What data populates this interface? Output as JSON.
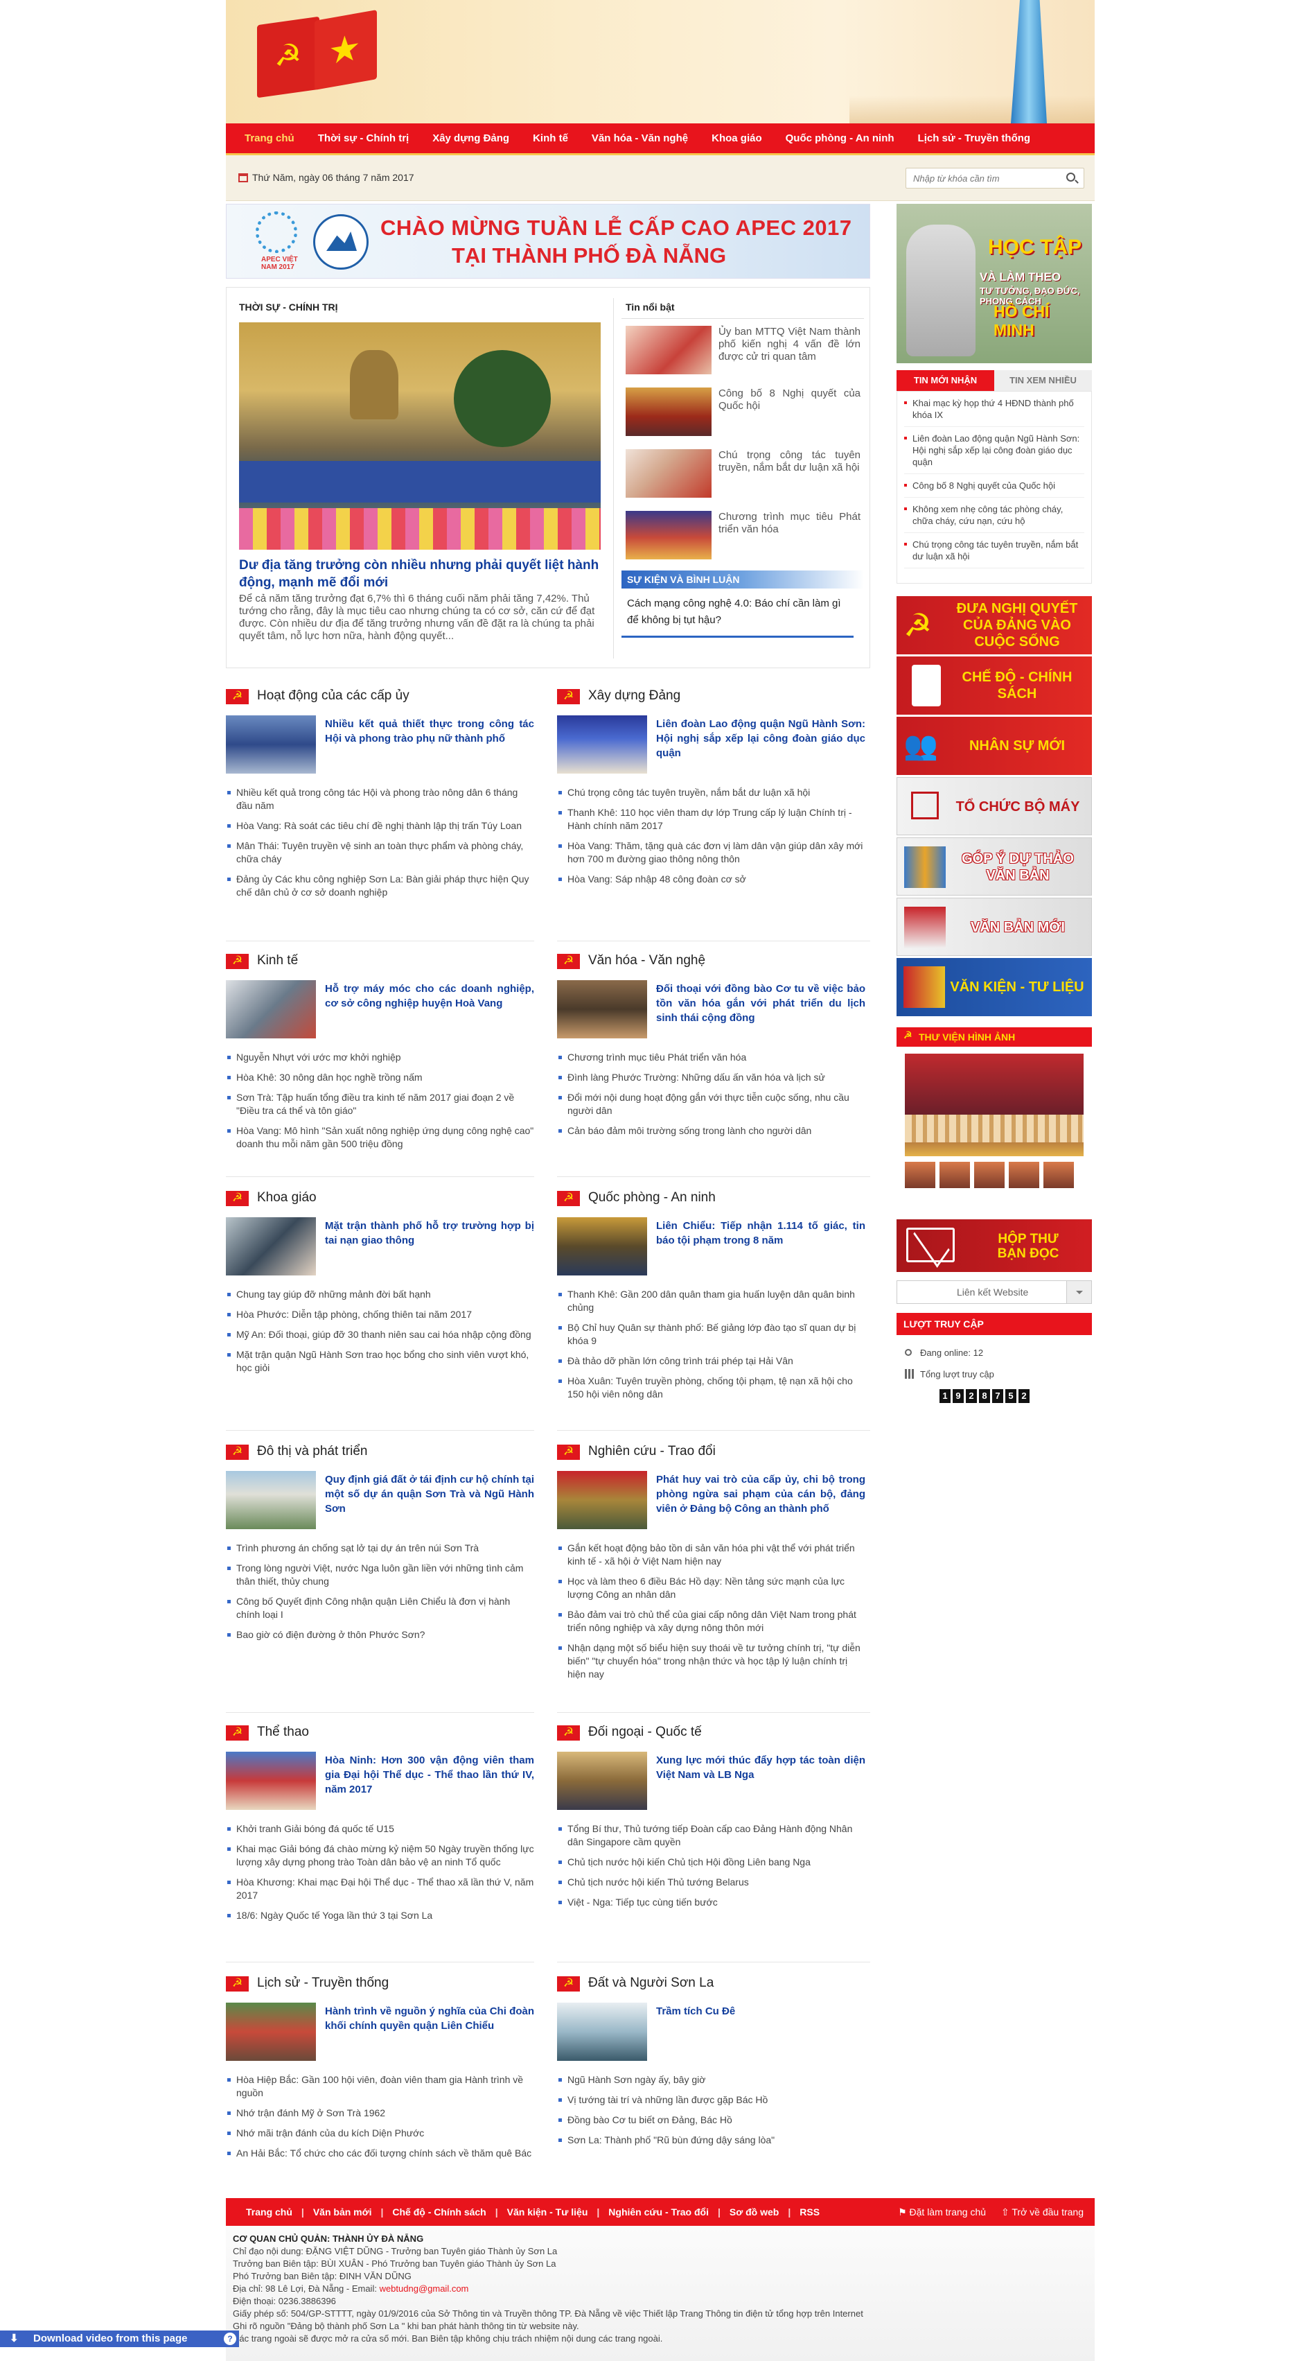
{
  "nav": [
    "Trang chủ",
    "Thời sự - Chính trị",
    "Xây dựng Đảng",
    "Kinh tế",
    "Văn hóa - Văn nghệ",
    "Khoa giáo",
    "Quốc phòng - An ninh",
    "Lịch sử - Truyền thống"
  ],
  "date": "Thứ Năm, ngày 06 tháng 7 năm 2017",
  "search": {
    "placeholder": "Nhập từ khóa cần tìm"
  },
  "apec": {
    "line1": "CHÀO MỪNG TUẦN LỄ CẤP CAO APEC 2017",
    "line2": "TẠI THÀNH PHỐ ĐÀ NẴNG",
    "logo_text": "APEC VIỆT NAM 2017"
  },
  "featured": {
    "label": "THỜI SỰ - CHÍNH TRỊ",
    "title": "Dư địa tăng trưởng còn nhiều nhưng phải quyết liệt hành động, mạnh mẽ đổi mới",
    "summary": "Để cả năm tăng trưởng đạt 6,7% thì 6 tháng cuối năm phải tăng 7,42%. Thủ tướng cho rằng, đây là mục tiêu cao nhưng chúng ta có cơ sở, căn cứ để đạt được. Còn nhiều dư địa để tăng trưởng nhưng vấn đề đặt ra là chúng ta phải quyết tâm, nỗ lực hơn nữa, hành động quyết..."
  },
  "hot": {
    "label": "Tin nổi bật",
    "items": [
      "Ủy ban MTTQ Việt Nam thành phố kiến nghị 4 vấn đề lớn được cử tri quan tâm",
      "Công bố 8 Nghị quyết của Quốc hội",
      "Chú trọng công tác tuyên truyền, nắm bắt dư luận xã hội",
      "Chương trình mục tiêu Phát triển văn hóa"
    ]
  },
  "sk": {
    "label": "SỰ KIỆN VÀ BÌNH LUẬN",
    "title": "Cách mạng công nghệ 4.0: Báo chí cần làm gì để không bị tụt hậu?"
  },
  "sections": [
    {
      "title": "Hoạt động của các cấp ủy",
      "lead": "Nhiều kết quả thiết thực trong công tác Hội và phong trào phụ nữ thành phố",
      "items": [
        "Nhiều kết quả trong công tác Hội và phong trào nông dân 6 tháng đầu năm",
        "Hòa Vang: Rà soát các tiêu chí đề nghị thành lập thị trấn Túy Loan",
        "Mân Thái: Tuyên truyền vệ sinh an toàn thực phẩm và phòng cháy, chữa cháy",
        "Đảng ủy Các khu công nghiệp Sơn La: Bàn giải pháp thực hiện Quy chế dân chủ ở cơ sở doanh nghiệp"
      ]
    },
    {
      "title": "Xây dựng Đảng",
      "lead": "Liên đoàn Lao động quận Ngũ Hành Sơn: Hội nghị sắp xếp lại công đoàn giáo dục quận",
      "items": [
        "Chú trọng công tác tuyên truyền, nắm bắt dư luận xã hội",
        "Thanh Khê: 110 học viên tham dự lớp Trung cấp lý luận Chính trị - Hành chính năm 2017",
        "Hòa Vang: Thăm, tặng quà các đơn vị làm dân vận giúp dân xây mới hơn 700 m đường giao thông nông thôn",
        "Hòa Vang: Sáp nhập 48 công đoàn cơ sở"
      ]
    },
    {
      "title": "Kinh tế",
      "lead": "Hỗ trợ máy móc cho các doanh nghiệp, cơ sở công nghiệp huyện Hoà Vang",
      "items": [
        "Nguyễn Nhựt với ước mơ khởi nghiệp",
        "Hòa Khê: 30 nông dân học nghề trồng nấm",
        "Sơn Trà: Tập huấn tổng điều tra kinh tế năm 2017 giai đoạn 2 về \"Điều tra cá thể và tôn giáo\"",
        "Hòa Vang: Mô hình \"Sản xuất nông nghiệp ứng dụng công nghệ cao\" doanh thu mỗi năm gần 500 triệu đồng"
      ]
    },
    {
      "title": "Văn hóa - Văn nghệ",
      "lead": "Đối thoại với đồng bào Cơ tu về việc bảo tồn văn hóa gắn với phát triển du lịch sinh thái cộng đồng",
      "items": [
        "Chương trình mục tiêu Phát triển văn hóa",
        "Đình làng Phước Trường: Những dấu ấn văn hóa và lịch sử",
        "Đổi mới nội dung hoạt động gắn với thực tiễn cuộc sống, nhu cầu người dân",
        "Cản báo đảm môi trường sống trong lành cho người dân"
      ]
    },
    {
      "title": "Khoa giáo",
      "lead": "Mặt trận thành phố hỗ trợ trường hợp bị tai nạn giao thông",
      "items": [
        "Chung tay giúp đỡ những mảnh đời bất hạnh",
        "Hòa Phước: Diễn tập phòng, chống thiên tai năm 2017",
        "Mỹ An: Đối thoại, giúp đỡ 30 thanh niên sau cai hóa nhập cộng đồng",
        "Mặt trận quận Ngũ Hành Sơn trao học bổng cho sinh viên vượt khó, học giỏi"
      ]
    },
    {
      "title": "Quốc phòng - An ninh",
      "lead": "Liên Chiểu: Tiếp nhận 1.114 tố giác, tin báo tội phạm trong 8 năm",
      "items": [
        "Thanh Khê: Gần 200 dân quân tham gia huấn luyện dân quân binh chủng",
        "Bộ Chỉ huy Quân sự thành phố: Bế giảng lớp đào tạo sĩ quan dự bị khóa 9",
        "Đà thảo dỡ phần lớn công trình trái phép tại Hải Vân",
        "Hòa Xuân: Tuyên truyền phòng, chống tội phạm, tệ nạn xã hội cho 150 hội viên nông dân"
      ]
    },
    {
      "title": "Đô thị và phát triển",
      "lead": "Quy định giá đất ở tái định cư hộ chính tại một số dự án quận Sơn Trà và Ngũ Hành Sơn",
      "items": [
        "Trình phương án chống sạt lở tại dự án trên núi Sơn Trà",
        "Trong lòng người Việt, nước Nga luôn gần liền với những tình cảm thân thiết, thủy chung",
        "Công bố Quyết định Công nhận quận Liên Chiểu là đơn vị hành chính loại I",
        "Bao giờ có điện đường ở thôn Phước Sơn?"
      ]
    },
    {
      "title": "Nghiên cứu - Trao đổi",
      "lead": "Phát huy vai trò của cấp ủy, chi bộ trong phòng ngừa sai phạm của cán bộ, đảng viên ở Đảng bộ Công an thành phố",
      "items": [
        "Gắn kết hoạt động bảo tồn di sản văn hóa phi vật thể với phát triển kinh tế - xã hội ở Việt Nam hiện nay",
        "Học và làm theo 6 điều Bác Hồ dạy: Nền tảng sức mạnh của lực lượng Công an nhân dân",
        "Bảo đảm vai trò chủ thể của giai cấp nông dân Việt Nam trong phát triển nông nghiệp và xây dựng nông thôn mới",
        "Nhận dạng một số biểu hiện suy thoái về tư tưởng chính trị, \"tự diễn biến\" \"tự chuyển hóa\" trong nhận thức và học tập lý luận chính trị hiện nay"
      ]
    },
    {
      "title": "Thể thao",
      "lead": "Hòa Ninh: Hơn 300 vận động viên tham gia Đại hội Thể dục - Thể thao lần thứ IV, năm 2017",
      "items": [
        "Khởi tranh Giải bóng đá quốc tế U15",
        "Khai mạc Giải bóng đá chào mừng kỷ niệm 50 Ngày truyền thống lực lượng xây dựng phong trào Toàn dân bảo vệ an ninh Tổ quốc",
        "Hòa Khương: Khai mạc Đại hội Thể dục - Thể thao xã lần thứ V, năm 2017",
        "18/6: Ngày Quốc tế Yoga lần thứ 3 tại Sơn La"
      ]
    },
    {
      "title": "Đối ngoại - Quốc tế",
      "lead": "Xung lực mới thúc đẩy hợp tác toàn diện Việt Nam và LB Nga",
      "items": [
        "Tổng Bí thư, Thủ tướng tiếp Đoàn cấp cao Đảng Hành động Nhân dân Singapore cầm quyền",
        "Chủ tịch nước hội kiến Chủ tịch Hội đồng Liên bang Nga",
        "Chủ tịch nước hội kiến Thủ tướng Belarus",
        "Việt - Nga: Tiếp tục cùng tiến bước"
      ]
    },
    {
      "title": "Lịch sử - Truyền thống",
      "lead": "Hành trình về nguồn ý nghĩa của Chi đoàn khối chính quyền quận Liên Chiểu",
      "items": [
        "Hòa Hiệp Bắc: Gần 100 hội viên, đoàn viên tham gia Hành trình về nguồn",
        "Nhớ trận đánh Mỹ ở Sơn Trà 1962",
        "Nhớ mãi trận đánh của du kích Diện Phước",
        "An Hải Bắc: Tổ chức cho các đối tượng chính sách về thăm quê Bác"
      ]
    },
    {
      "title": "Đất và Người Sơn La",
      "lead": "Trầm tích Cu Đê",
      "items": [
        "Ngũ Hành Sơn ngày ấy, bây giờ",
        "Vị tướng tài trí và những lần được gặp Bác Hồ",
        "Đồng bào Cơ tu biết ơn Đảng, Bác Hồ",
        "Sơn La: Thành phố \"Rũ bùn đứng dậy sáng lòa\""
      ]
    }
  ],
  "right": {
    "hcm": {
      "l1": "HỌC TẬP",
      "l2": "VÀ LÀM THEO",
      "l3": "TƯ TƯỞNG, ĐẠO ĐỨC, PHONG CÁCH",
      "l4": "HỒ CHÍ MINH"
    },
    "tab_new": "TIN MỚI NHẬN",
    "tab_most": "TIN XEM NHIỀU",
    "newlist": [
      "Khai mạc kỳ họp thứ 4 HĐND thành phố khóa IX",
      "Liên đoàn Lao động quận Ngũ Hành Sơn: Hội nghị sắp xếp lại công đoàn giáo dục quận",
      "Công bố 8 Nghị quyết của Quốc hội",
      "Không xem nhẹ công tác phòng cháy, chữa cháy, cứu nạn, cứu hộ",
      "Chú trọng công tác tuyên truyền, nắm bắt dư luận xã hội"
    ],
    "banners": [
      "ĐƯA NGHỊ QUYẾT CỦA ĐẢNG VÀO CUỘC SỐNG",
      "CHẾ ĐỘ - CHÍNH SÁCH",
      "NHÂN SỰ MỚI",
      "TỔ CHỨC BỘ MÁY",
      "GÓP Ý DỰ THẢO VĂN BẢN",
      "VĂN BẢN MỚI",
      "VĂN KIỆN - TƯ LIỆU"
    ],
    "library": "THƯ VIỆN HÌNH ẢNH",
    "mail": "HỘP THƯ BẠN ĐỌC",
    "links": "Liên kết Website",
    "stat_title": "LƯỢT TRUY CẬP",
    "online": "Đang online: 12",
    "total_label": "Tổng lượt truy cập",
    "counter": [
      "1",
      "9",
      "2",
      "8",
      "7",
      "5",
      "2"
    ]
  },
  "footer": {
    "links": [
      "Trang chủ",
      "Văn bản mới",
      "Chế độ - Chính sách",
      "Văn kiện - Tư liệu",
      "Nghiên cứu - Trao đổi",
      "Sơ đồ web",
      "RSS"
    ],
    "home": "Đặt làm trang chủ",
    "top": "Trở về đầu trang",
    "org": "CƠ QUAN CHỦ QUẢN: THÀNH ỦY ĐÀ NẴNG",
    "lines": [
      "Chỉ đạo nội dung: ĐẶNG VIỆT DŨNG - Trưởng ban Tuyên giáo Thành ủy Sơn La",
      "Trưởng ban Biên tập: BÙI XUÂN - Phó Trưởng ban Tuyên giáo Thành ủy Sơn La",
      "Phó Trưởng ban Biên tập: ĐINH VĂN DŨNG"
    ],
    "address": "Địa chỉ: 98 Lê Lợi, Đà Nẵng - Email: ",
    "email": "webtudng@gmail.com",
    "phone": "Điện thoại: 0236.3886396",
    "license": "Giấy phép số: 504/GP-STTTT, ngày 01/9/2016 của Sở Thông tin và Truyền thông TP. Đà Nẵng về việc Thiết lập Trang Thông tin điện tử tổng hợp trên Internet",
    "note1": "Ghi rõ nguồn \"Đảng bộ thành phố Sơn La \" khi ban phát hành thông tin từ website này.",
    "note2": "Các trang ngoài sẽ được mở ra cửa số mới. Ban Biên tập không chịu trách nhiệm nội dung các trang ngoài."
  },
  "download": "Download video from this page"
}
